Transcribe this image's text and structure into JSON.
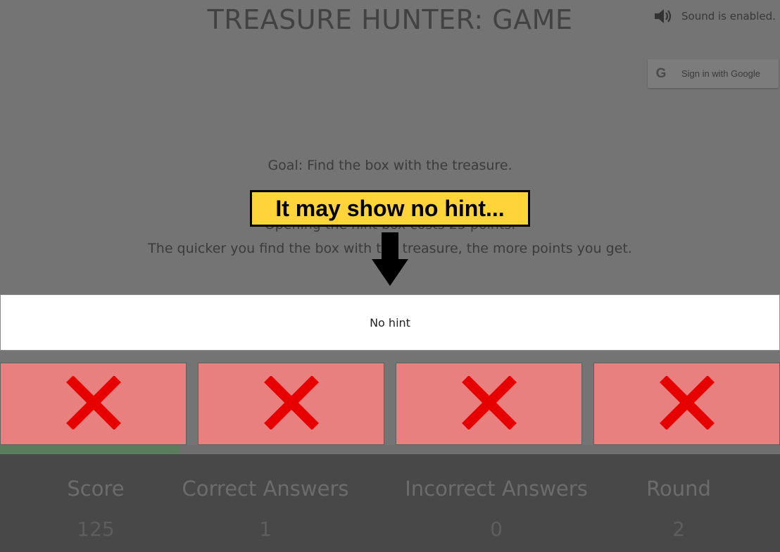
{
  "header": {
    "title": "TREASURE HUNTER: GAME",
    "sound_icon": "speaker-icon",
    "sound_text": "Sound is enabled.",
    "google_signin_label": "Sign in with Google",
    "google_icon": "google-g-icon"
  },
  "instructions": {
    "goal": "Goal: Find the box with the treasure.",
    "hint_cost": "Opening the hint box costs 25 points.",
    "speed": "The quicker you find the box with the treasure, the more points you get."
  },
  "callout": {
    "text": "It may show no hint...",
    "arrow_icon": "arrow-down-icon",
    "color": "#ffd43a"
  },
  "hint_panel": {
    "text": "No hint"
  },
  "boxes": [
    {
      "icon": "x-mark-icon",
      "state": "opened-empty"
    },
    {
      "icon": "x-mark-icon",
      "state": "opened-empty"
    },
    {
      "icon": "x-mark-icon",
      "state": "opened-empty"
    },
    {
      "icon": "x-mark-icon",
      "state": "opened-empty"
    }
  ],
  "box_color": "#e88080",
  "cross_color": "#e60000",
  "progress": {
    "fraction": 0.23,
    "color": "#5a7e5d"
  },
  "stats": [
    {
      "label": "Score",
      "value": "125"
    },
    {
      "label": "Correct Answers",
      "value": "1"
    },
    {
      "label": "Incorrect Answers",
      "value": "0"
    },
    {
      "label": "Round",
      "value": "2"
    }
  ]
}
